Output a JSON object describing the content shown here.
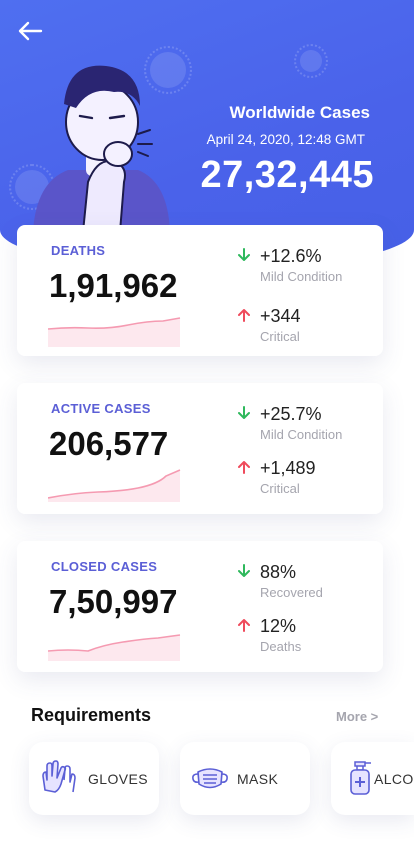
{
  "header": {
    "back_icon": "arrow-left-icon",
    "title": "Worldwide Cases",
    "date": "April 24, 2020, 12:48 GMT",
    "total": "27,32,445"
  },
  "colors": {
    "hero": "#4f6ff0",
    "label": "#5b5fd6",
    "up_arrow": "#ef4b5c",
    "down_arrow": "#2eb85c",
    "spark": "#f59ab1"
  },
  "cards": [
    {
      "label": "DEATHS",
      "value": "1,91,962",
      "stats": [
        {
          "direction": "down",
          "value": "+12.6%",
          "sub": "Mild Condition"
        },
        {
          "direction": "up",
          "value": "+344",
          "sub": "Critical"
        }
      ]
    },
    {
      "label": "ACTIVE CASES",
      "value": "206,577",
      "stats": [
        {
          "direction": "down",
          "value": "+25.7%",
          "sub": "Mild Condition"
        },
        {
          "direction": "up",
          "value": "+1,489",
          "sub": "Critical"
        }
      ]
    },
    {
      "label": "CLOSED CASES",
      "value": "7,50,997",
      "stats": [
        {
          "direction": "down",
          "value": "88%",
          "sub": "Recovered"
        },
        {
          "direction": "up",
          "value": "12%",
          "sub": "Deaths"
        }
      ]
    }
  ],
  "requirements": {
    "title": "Requirements",
    "more": "More >",
    "items": [
      {
        "label": "GLOVES",
        "icon": "gloves-icon"
      },
      {
        "label": "MASK",
        "icon": "mask-icon"
      },
      {
        "label": "ALCO",
        "icon": "sanitizer-icon"
      }
    ]
  }
}
